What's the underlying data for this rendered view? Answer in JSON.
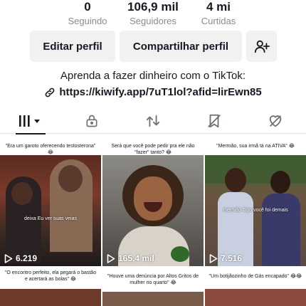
{
  "stats": {
    "following": {
      "value": "0",
      "label": "Seguindo"
    },
    "followers": {
      "value": "106,9 mil",
      "label": "Seguidores"
    },
    "likes": {
      "value": "4 mi",
      "label": "Curtidas"
    }
  },
  "actions": {
    "edit_label": "Editar perfil",
    "share_label": "Compartilhar perfil",
    "add_friend_icon": "add-user-icon"
  },
  "bio": {
    "text": "Aprenda a fazer dinheiro com o TikTok:",
    "link": "https://kiwify.app/7uT1lol?afid=lirEwn85"
  },
  "tabs": [
    {
      "icon": "grid-icon",
      "active": true
    },
    {
      "icon": "lock-icon",
      "active": false
    },
    {
      "icon": "repost-icon",
      "active": false
    },
    {
      "icon": "favorites-icon",
      "active": false
    },
    {
      "icon": "liked-heart-icon",
      "active": false
    }
  ],
  "videos": [
    {
      "caption": "\"Era um garoto oferecendo testosterona\" 😂",
      "subtitle": "deixa Eu ver suas veias",
      "views": "6.219"
    },
    {
      "caption": "Será que você pode pedir pra ele não \"fazer\" tanto? 😂",
      "subtitle": "",
      "views": "165,4 mil"
    },
    {
      "caption": "\"Mermão, sua irmã tá na ATIVA\" 😂",
      "subtitle": "mermão Tipo você foi demais",
      "views": "7.516"
    },
    {
      "caption": "\"O encontro perfeito, ela pegará o bastão e acertará as bolas\" 😂",
      "subtitle": "",
      "views": ""
    },
    {
      "caption": "\"Houve uma denúncia por Altos Gritos de mulher no quarto\" 😂",
      "subtitle": "",
      "views": ""
    },
    {
      "caption": "\"Um botijãozinho de Gás encapado\" 😂😂",
      "subtitle": "",
      "views": ""
    }
  ],
  "colors": {
    "text": "#161823",
    "muted": "#8a8b91",
    "button_bg": "#f1f1f2"
  }
}
